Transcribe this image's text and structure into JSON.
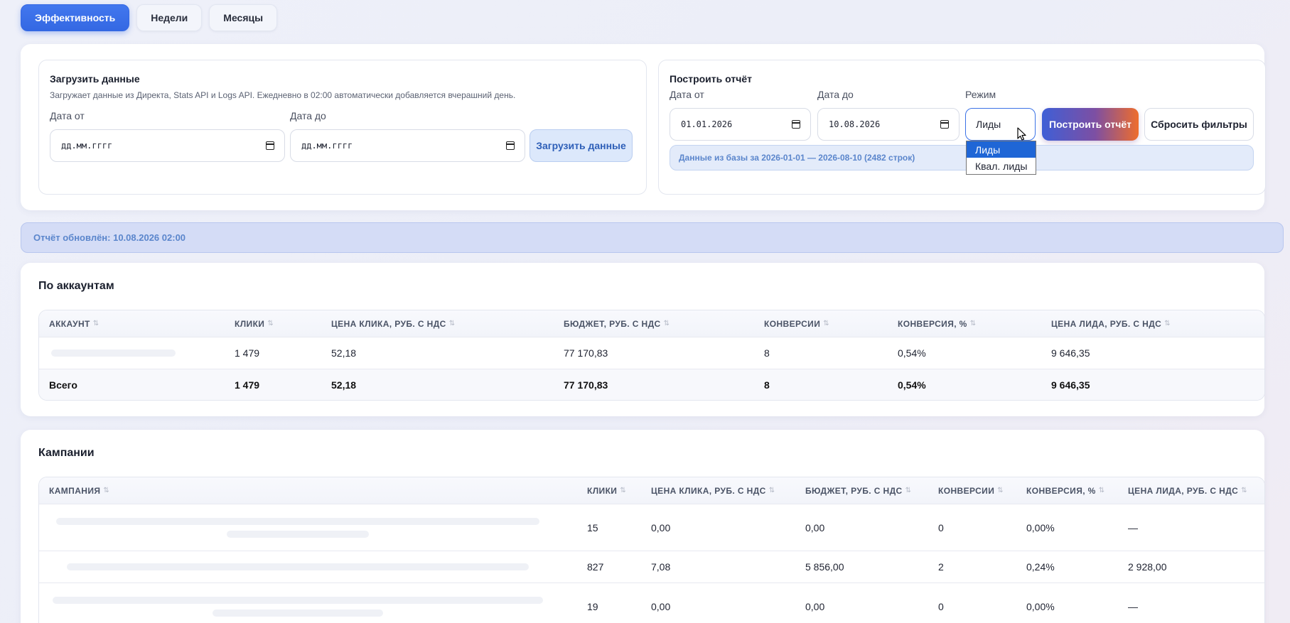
{
  "tabs": [
    {
      "label": "Эффективность",
      "active": true
    },
    {
      "label": "Недели",
      "active": false
    },
    {
      "label": "Месяцы",
      "active": false
    }
  ],
  "load_panel": {
    "title": "Загрузить данные",
    "description": "Загружает данные из Директа, Stats API и Logs API. Ежедневно в 02:00 автоматически добавляется вчерашний день.",
    "date_from_label": "Дата от",
    "date_from_value": "дд.мм.гггг",
    "date_to_label": "Дата до",
    "date_to_value": "дд.мм.гггг",
    "button": "Загрузить данные"
  },
  "report_panel": {
    "title": "Построить отчёт",
    "date_from_label": "Дата от",
    "date_from_value": "01.01.2026",
    "date_to_label": "Дата до",
    "date_to_value": "10.08.2026",
    "mode_label": "Режим",
    "mode_value": "Лиды",
    "mode_options": [
      "Лиды",
      "Квал. лиды"
    ],
    "build_button": "Построить отчёт",
    "reset_button": "Сбросить фильтры",
    "info": "Данные из базы за 2026-01-01 — 2026-08-10 (2482 строк)"
  },
  "update_status": "Отчёт обновлён: 10.08.2026 02:00",
  "accounts": {
    "title": "По аккаунтам",
    "columns": [
      "АККАУНТ",
      "КЛИКИ",
      "ЦЕНА КЛИКА, РУБ. С НДС",
      "БЮДЖЕТ, РУБ. С НДС",
      "КОНВЕРСИИ",
      "КОНВЕРСИЯ, %",
      "ЦЕНА ЛИДА, РУБ. С НДС"
    ],
    "rows": [
      {
        "account": "",
        "clicks": "1 479",
        "cpc": "52,18",
        "budget": "77 170,83",
        "conversions": "8",
        "conv_rate": "0,54%",
        "cpl": "9 646,35"
      }
    ],
    "total": {
      "account": "Всего",
      "clicks": "1 479",
      "cpc": "52,18",
      "budget": "77 170,83",
      "conversions": "8",
      "conv_rate": "0,54%",
      "cpl": "9 646,35"
    }
  },
  "campaigns": {
    "title": "Кампании",
    "columns": [
      "КАМПАНИЯ",
      "КЛИКИ",
      "ЦЕНА КЛИКА, РУБ. С НДС",
      "БЮДЖЕТ, РУБ. С НДС",
      "КОНВЕРСИИ",
      "КОНВЕРСИЯ, %",
      "ЦЕНА ЛИДА, РУБ. С НДС"
    ],
    "rows": [
      {
        "campaign": "",
        "clicks": "15",
        "cpc": "0,00",
        "budget": "0,00",
        "conversions": "0",
        "conv_rate": "0,00%",
        "cpl": "—"
      },
      {
        "campaign": "",
        "clicks": "827",
        "cpc": "7,08",
        "budget": "5 856,00",
        "conversions": "2",
        "conv_rate": "0,24%",
        "cpl": "2 928,00"
      },
      {
        "campaign": "",
        "clicks": "19",
        "cpc": "0,00",
        "budget": "0,00",
        "conversions": "0",
        "conv_rate": "0,00%",
        "cpl": "—"
      }
    ]
  },
  "colors": {
    "accent": "#3468e3",
    "info_bg": "#e3ebfa",
    "info_text": "#5b86cc",
    "build_gradient_start": "#3f5fd6",
    "build_gradient_end": "#ee6d2c"
  }
}
